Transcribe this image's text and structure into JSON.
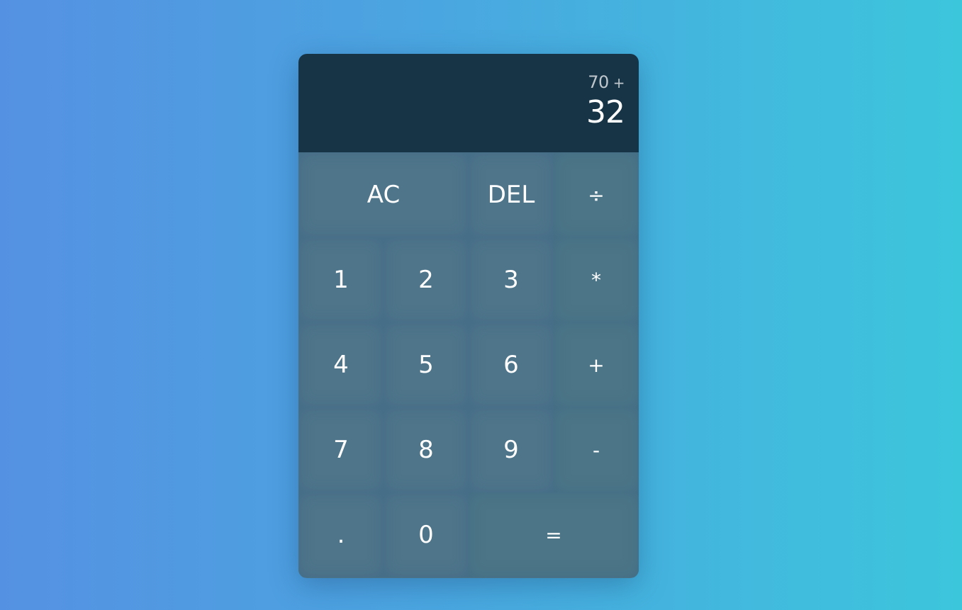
{
  "display": {
    "previous_operand": "70",
    "operation": "+",
    "current_operand": "32"
  },
  "keys": {
    "ac": "AC",
    "del": "DEL",
    "divide": "÷",
    "one": "1",
    "two": "2",
    "three": "3",
    "multiply": "*",
    "four": "4",
    "five": "5",
    "six": "6",
    "add": "+",
    "seven": "7",
    "eight": "8",
    "nine": "9",
    "subtract": "-",
    "decimal": ".",
    "zero": "0",
    "equals": "="
  },
  "colors": {
    "display_bg": "#173447",
    "keypad_bg": "#4a7388",
    "text": "#ffffff",
    "background_start": "#5591e2",
    "background_end": "#3cc6dc"
  }
}
